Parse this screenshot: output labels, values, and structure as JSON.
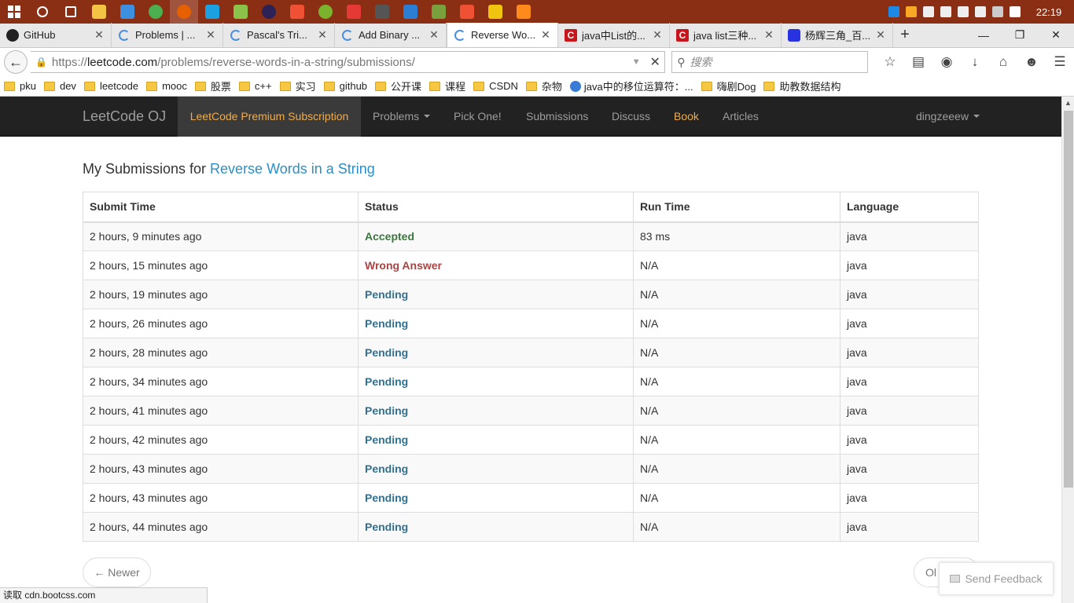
{
  "taskbar": {
    "clock": "22:19",
    "icons": [
      {
        "name": "search-icon",
        "color": "#ffffff"
      },
      {
        "name": "task-view-icon",
        "color": "#ffffff"
      },
      {
        "name": "file-explorer-icon",
        "color": "#f3c343"
      },
      {
        "name": "monitor-icon",
        "color": "#3d8fe0"
      },
      {
        "name": "green-app-icon",
        "color": "#4cb050"
      },
      {
        "name": "firefox-icon",
        "color": "#e66000"
      },
      {
        "name": "blue-app-icon",
        "color": "#1ba1e2"
      },
      {
        "name": "android-icon",
        "color": "#8bc34a"
      },
      {
        "name": "eclipse-icon",
        "color": "#2c2255"
      },
      {
        "name": "git-icon",
        "color": "#f05033"
      },
      {
        "name": "wechat-icon",
        "color": "#7bb32e"
      },
      {
        "name": "colorful-app-icon",
        "color": "#e53935"
      },
      {
        "name": "settings-app-icon",
        "color": "#555555"
      },
      {
        "name": "vs-code-icon",
        "color": "#2a7fd5"
      },
      {
        "name": "android-studio-icon",
        "color": "#78a03c"
      },
      {
        "name": "git-gui-icon",
        "color": "#f05033"
      },
      {
        "name": "notes-app-icon",
        "color": "#f1c40f"
      },
      {
        "name": "g-app-icon",
        "color": "#ff8a1c"
      }
    ],
    "tray": [
      {
        "name": "tray-app-icon",
        "color": "#1e88e5"
      },
      {
        "name": "tray-weather-icon",
        "color": "#f9a825"
      },
      {
        "name": "tray-battery-icon",
        "color": "#eeeeee"
      },
      {
        "name": "tray-network-icon",
        "color": "#eeeeee"
      },
      {
        "name": "tray-volume-icon",
        "color": "#eeeeee"
      },
      {
        "name": "tray-message-icon",
        "color": "#eeeeee"
      },
      {
        "name": "tray-close-icon",
        "color": "#cccccc"
      },
      {
        "name": "tray-q-icon",
        "color": "#ffffff"
      }
    ]
  },
  "tabs": [
    {
      "title": "GitHub",
      "favicon": "github"
    },
    {
      "title": "Problems | ...",
      "favicon": "spinner"
    },
    {
      "title": "Pascal's Tri...",
      "favicon": "spinner"
    },
    {
      "title": "Add Binary ...",
      "favicon": "spinner"
    },
    {
      "title": "Reverse Wo...",
      "favicon": "spinner",
      "active": true
    },
    {
      "title": "java中List的...",
      "favicon": "c"
    },
    {
      "title": "java list三种...",
      "favicon": "c"
    },
    {
      "title": "杨辉三角_百...",
      "favicon": "baidu"
    }
  ],
  "navbar": {
    "url_scheme": "https://",
    "url_host": "leetcode.com",
    "url_path": "/problems/reverse-words-in-a-string/submissions/",
    "search_placeholder": "搜索"
  },
  "bookmarks": [
    "pku",
    "dev",
    "leetcode",
    "mooc",
    "股票",
    "c++",
    "实习",
    "github",
    "公开课",
    "课程",
    "CSDN",
    "杂物",
    "java中的移位运算符：...",
    "嗨剧Dog",
    "助教数据结构"
  ],
  "leetcode_nav": {
    "brand": "LeetCode OJ",
    "premium": "LeetCode Premium Subscription",
    "problems": "Problems",
    "pick_one": "Pick One!",
    "submissions": "Submissions",
    "discuss": "Discuss",
    "book": "Book",
    "articles": "Articles",
    "user": "dingzeeew"
  },
  "main": {
    "heading_prefix": "My Submissions for ",
    "heading_link": "Reverse Words in a String",
    "columns": [
      "Submit Time",
      "Status",
      "Run Time",
      "Language"
    ],
    "rows": [
      {
        "time": "2 hours, 9 minutes ago",
        "status": "Accepted",
        "status_kind": "accepted",
        "runtime": "83 ms",
        "language": "java"
      },
      {
        "time": "2 hours, 15 minutes ago",
        "status": "Wrong Answer",
        "status_kind": "wrong",
        "runtime": "N/A",
        "language": "java"
      },
      {
        "time": "2 hours, 19 minutes ago",
        "status": "Pending",
        "status_kind": "pending",
        "runtime": "N/A",
        "language": "java"
      },
      {
        "time": "2 hours, 26 minutes ago",
        "status": "Pending",
        "status_kind": "pending",
        "runtime": "N/A",
        "language": "java"
      },
      {
        "time": "2 hours, 28 minutes ago",
        "status": "Pending",
        "status_kind": "pending",
        "runtime": "N/A",
        "language": "java"
      },
      {
        "time": "2 hours, 34 minutes ago",
        "status": "Pending",
        "status_kind": "pending",
        "runtime": "N/A",
        "language": "java"
      },
      {
        "time": "2 hours, 41 minutes ago",
        "status": "Pending",
        "status_kind": "pending",
        "runtime": "N/A",
        "language": "java"
      },
      {
        "time": "2 hours, 42 minutes ago",
        "status": "Pending",
        "status_kind": "pending",
        "runtime": "N/A",
        "language": "java"
      },
      {
        "time": "2 hours, 43 minutes ago",
        "status": "Pending",
        "status_kind": "pending",
        "runtime": "N/A",
        "language": "java"
      },
      {
        "time": "2 hours, 43 minutes ago",
        "status": "Pending",
        "status_kind": "pending",
        "runtime": "N/A",
        "language": "java"
      },
      {
        "time": "2 hours, 44 minutes ago",
        "status": "Pending",
        "status_kind": "pending",
        "runtime": "N/A",
        "language": "java"
      }
    ],
    "pager_newer": "← Newer",
    "pager_older": "Ol",
    "feedback": "Send Feedback"
  },
  "statusbar": "读取 cdn.bootcss.com",
  "colors": {
    "taskbar_bg": "#8b2f14",
    "nav_bg": "#222222",
    "link": "#2a8fc9",
    "premium": "#f0ad4e",
    "accepted": "#3c763d",
    "wrong": "#a94442",
    "pending": "#31708f"
  }
}
